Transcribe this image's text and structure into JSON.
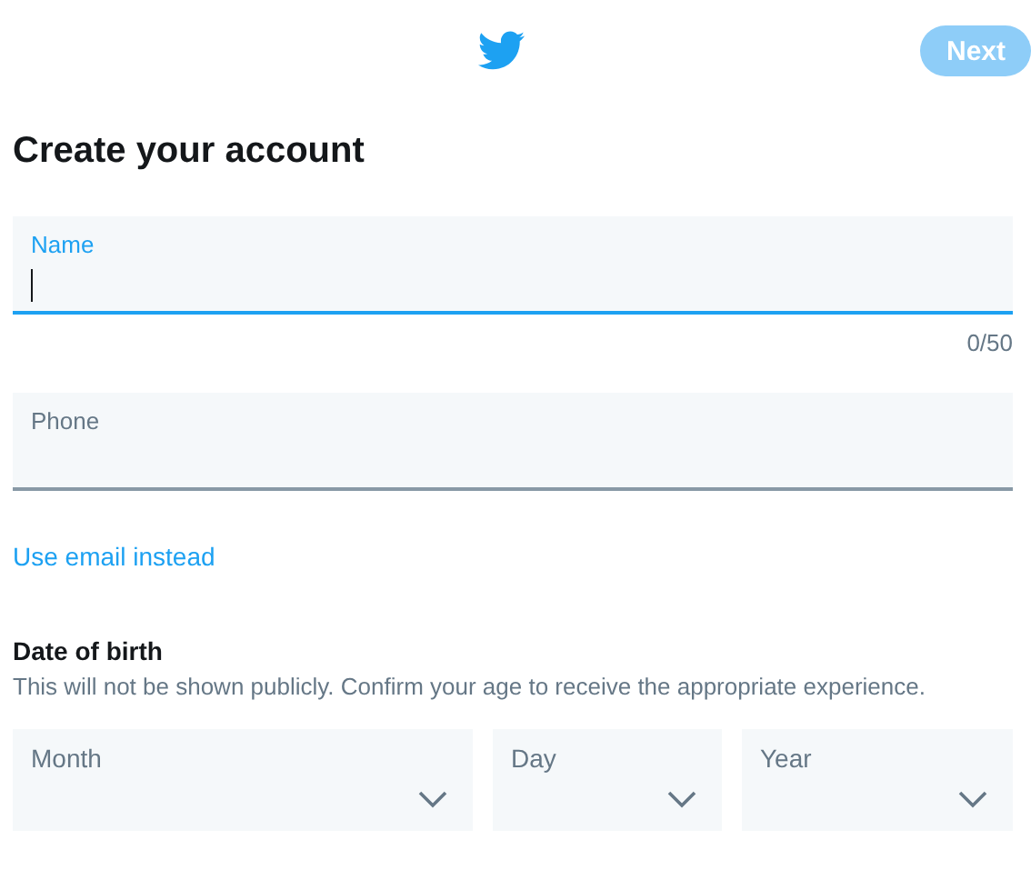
{
  "header": {
    "next_button": {
      "label": "Next",
      "disabled": true
    }
  },
  "title": "Create your account",
  "fields": [
    {
      "label": "Name",
      "focused": true,
      "counter": "0/50"
    },
    {
      "label": "Phone",
      "focused": false
    }
  ],
  "email_link": "Use email instead",
  "birth": {
    "heading": "Date of birth",
    "note": "This will not be shown publicly. Confirm your age to receive the appropriate experience.",
    "selects": [
      {
        "label": "Month"
      },
      {
        "label": "Day"
      },
      {
        "label": "Year"
      }
    ]
  }
}
